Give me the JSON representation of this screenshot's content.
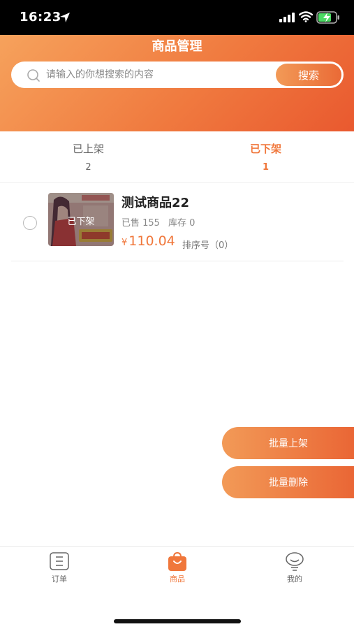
{
  "status_bar": {
    "time": "16:23"
  },
  "header": {
    "title": "商品管理"
  },
  "search": {
    "placeholder": "请输入的你想搜索的内容",
    "value": "",
    "button_label": "搜索"
  },
  "tabs": [
    {
      "label": "已上架",
      "count": "2",
      "active": false
    },
    {
      "label": "已下架",
      "count": "1",
      "active": true
    }
  ],
  "products": [
    {
      "name": "测试商品22",
      "status_overlay": "已下架",
      "sold": "已售 155",
      "stock": "库存 0",
      "price_symbol": "¥",
      "price": "110.04",
      "sort": "排序号（0）"
    }
  ],
  "actions": {
    "batch_on_shelf": "批量上架",
    "batch_delete": "批量删除"
  },
  "nav": [
    {
      "label": "订单",
      "icon": "order-list-icon",
      "active": false
    },
    {
      "label": "商品",
      "icon": "shopping-bag-icon",
      "active": true
    },
    {
      "label": "我的",
      "icon": "profile-chat-icon",
      "active": false
    }
  ],
  "colors": {
    "accent": "#f0773b",
    "header_start": "#f6a25c",
    "header_end": "#e9592f"
  }
}
